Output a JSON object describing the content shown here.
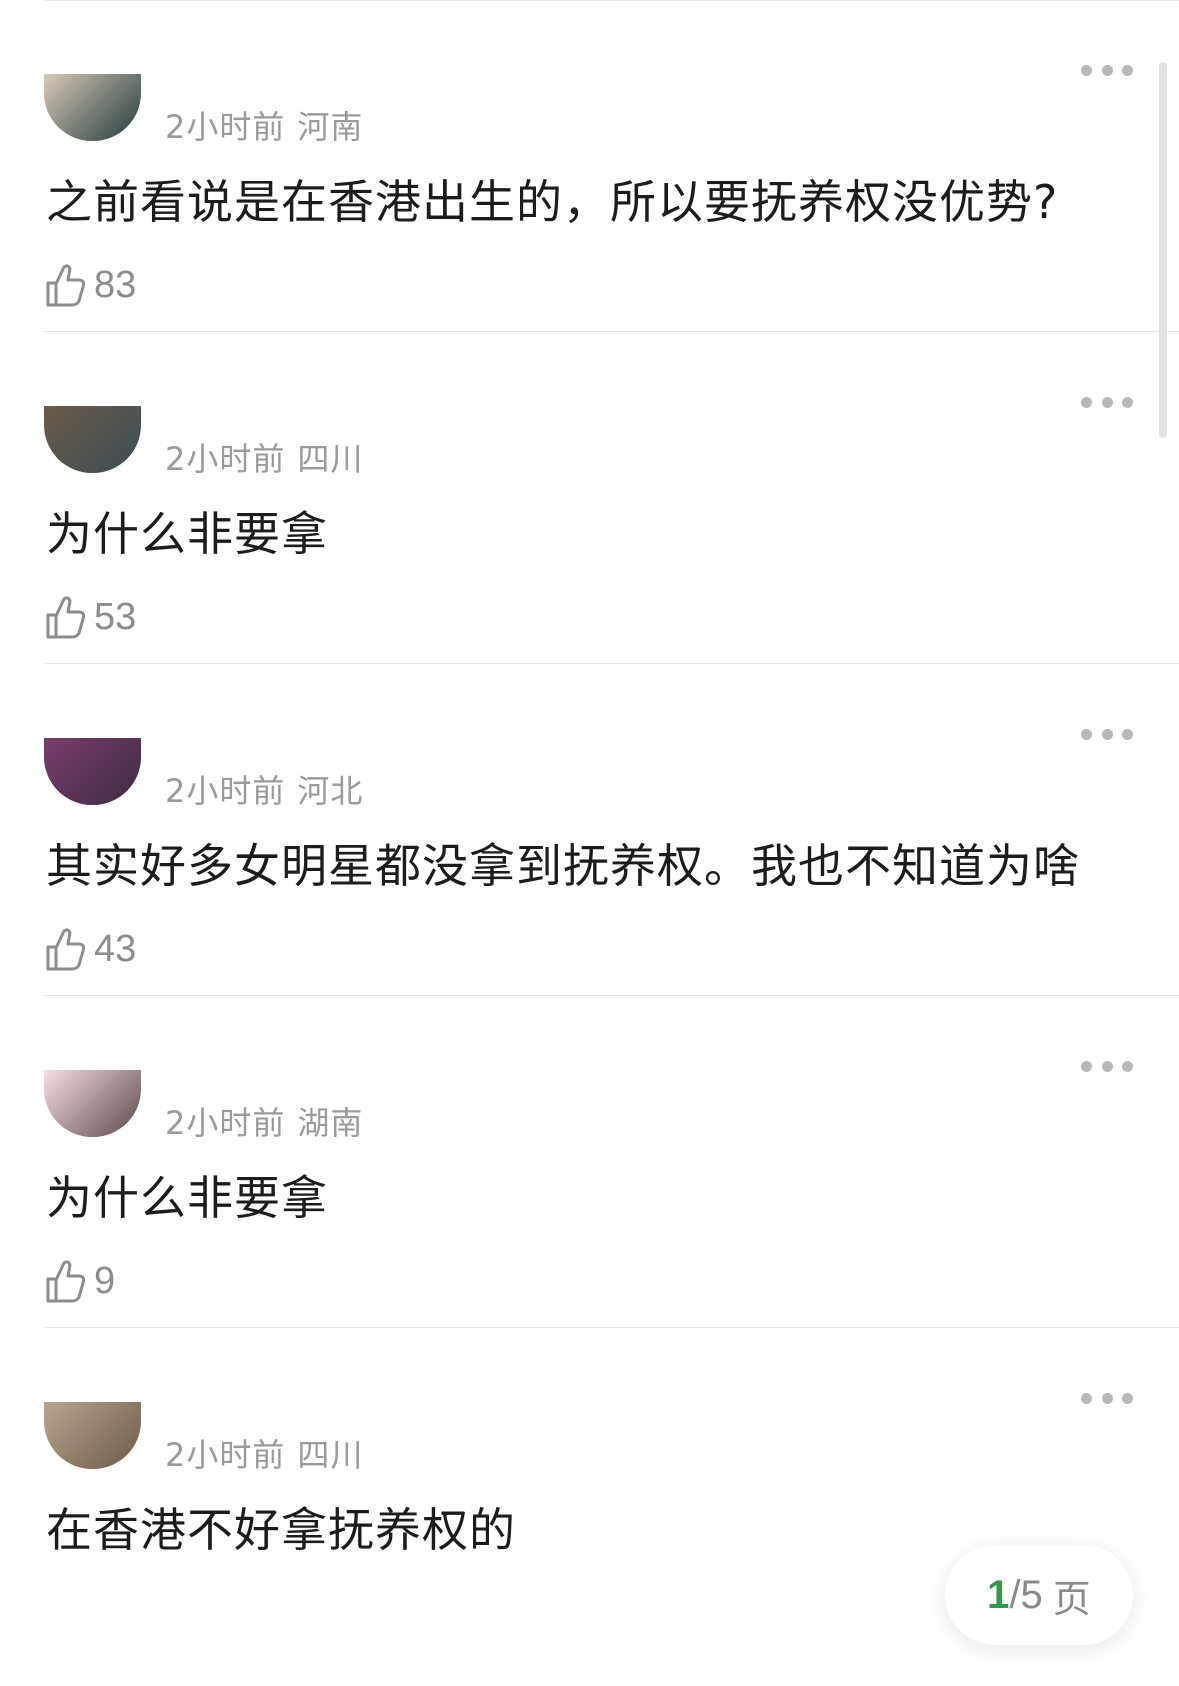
{
  "comments": [
    {
      "time": "2小时前",
      "region": "河南",
      "text": "之前看说是在香港出生的，所以要抚养权没优势?",
      "likes": "83",
      "avatar_colors": [
        "#d9c9b8",
        "#1f3a3a"
      ]
    },
    {
      "time": "2小时前",
      "region": "四川",
      "text": "为什么非要拿",
      "likes": "53",
      "avatar_colors": [
        "#6b5a48",
        "#3a4e56"
      ]
    },
    {
      "time": "2小时前",
      "region": "河北",
      "text": "其实好多女明星都没拿到抚养权。我也不知道为啥",
      "likes": "43",
      "avatar_colors": [
        "#7a3c6e",
        "#3b2d3e"
      ]
    },
    {
      "time": "2小时前",
      "region": "湖南",
      "text": "为什么非要拿",
      "likes": "9",
      "avatar_colors": [
        "#f6dde2",
        "#5a4a4a"
      ]
    },
    {
      "time": "2小时前",
      "region": "四川",
      "text": "在香港不好拿抚养权的",
      "likes": "",
      "avatar_colors": [
        "#b9a58f",
        "#6a5a4a"
      ]
    }
  ],
  "pager": {
    "current": "1",
    "separator": "/",
    "total": "5",
    "unit": "页"
  },
  "icons": {
    "more": "more-dots-icon",
    "like": "thumbs-up-icon"
  },
  "colors": {
    "accent": "#2e9a4a",
    "meta": "#9a9a9a",
    "likes": "#8c8c8c"
  }
}
